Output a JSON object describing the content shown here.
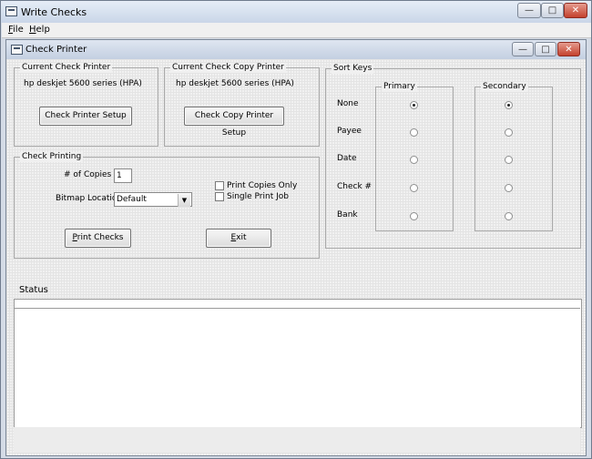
{
  "outer_window": {
    "title": "Write Checks",
    "controls": {
      "minimize": "—",
      "maximize": "□",
      "close": "✕"
    }
  },
  "menu": {
    "items": [
      {
        "label": "File",
        "accel": "F"
      },
      {
        "label": "Help",
        "accel": "H"
      }
    ]
  },
  "child_window": {
    "title": "Check Printer",
    "controls": {
      "minimize": "—",
      "maximize": "□",
      "close": "✕"
    }
  },
  "current_check_printer": {
    "legend": "Current Check  Printer",
    "printer": "hp deskjet 5600 series (HPA)",
    "setup_button": "Check Printer Setup"
  },
  "current_copy_printer": {
    "legend": "Current Check Copy Printer",
    "printer": "hp deskjet 5600 series (HPA)",
    "setup_button": "Check Copy Printer Setup"
  },
  "check_printing": {
    "legend": "Check Printing",
    "copies_label": "# of Copies",
    "copies_value": "1",
    "bitmap_label": "Bitmap Location",
    "bitmap_value": "Default",
    "print_copies_only": "Print Copies Only",
    "single_print_job": "Single Print Job",
    "print_button": "Print Checks",
    "exit_button": "Exit"
  },
  "sort_keys": {
    "legend": "Sort Keys",
    "primary_legend": "Primary",
    "secondary_legend": "Secondary",
    "rows": [
      "None",
      "Payee",
      "Date",
      "Check #",
      "Bank"
    ],
    "primary_selected": "None",
    "secondary_selected": "None"
  },
  "status": {
    "label": "Status"
  }
}
